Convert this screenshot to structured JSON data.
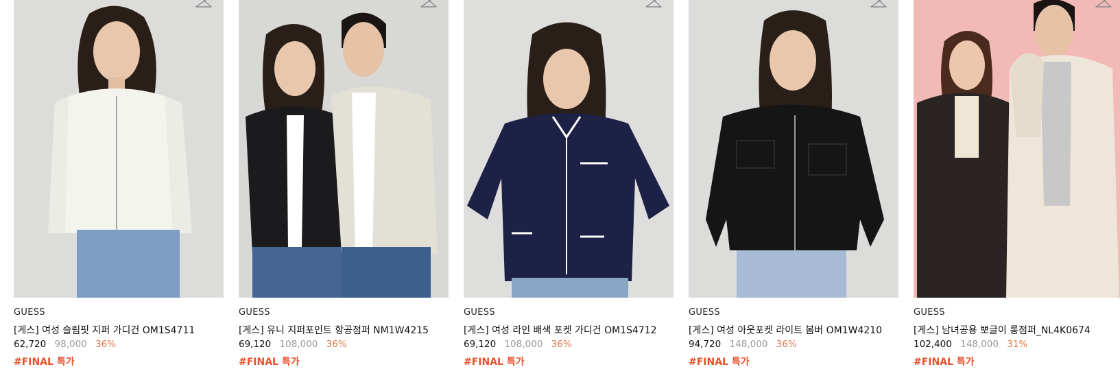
{
  "products": [
    {
      "brand": "GUESS",
      "title": "[게스] 여성 슬림핏 지퍼 가디건 OM1S4711",
      "price": "62,720",
      "original_price": "98,000",
      "discount": "36%",
      "tag": "#FINAL 특가",
      "icon": "hanger-icon",
      "garment_color": "#f3f3ef",
      "background": "#dcdcda"
    },
    {
      "brand": "GUESS",
      "title": "[게스] 유니 지퍼포인트 항공점퍼 NM1W4215",
      "price": "69,120",
      "original_price": "108,000",
      "discount": "36%",
      "tag": "#FINAL 특가",
      "icon": "hanger-icon",
      "garment_color": "#1b1b1d",
      "background": "#d8d8d6"
    },
    {
      "brand": "GUESS",
      "title": "[게스] 여성 라인 배색 포켓 가디건 OM1S4712",
      "price": "69,120",
      "original_price": "108,000",
      "discount": "36%",
      "tag": "#FINAL 특가",
      "icon": "hanger-icon",
      "garment_color": "#1d2145",
      "background": "#dededc"
    },
    {
      "brand": "GUESS",
      "title": "[게스] 여성 아웃포켓 라이트 봄버 OM1W4210",
      "price": "94,720",
      "original_price": "148,000",
      "discount": "36%",
      "tag": "#FINAL 특가",
      "icon": "hanger-icon",
      "garment_color": "#141414",
      "background": "#dcdcda"
    },
    {
      "brand": "GUESS",
      "title": "[게스] 남녀공용 뽀글이 롱점퍼_NL4K0674",
      "price": "102,400",
      "original_price": "148,000",
      "discount": "31%",
      "tag": "#FINAL 특가",
      "icon": "hanger-icon",
      "garment_color": "#efe6da",
      "background": "#f3b9b6"
    }
  ]
}
